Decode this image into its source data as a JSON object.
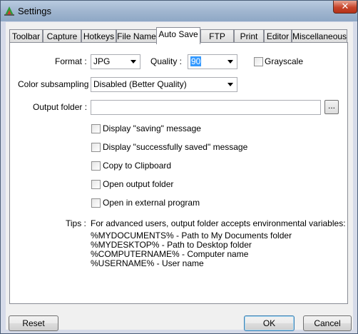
{
  "window": {
    "title": "Settings"
  },
  "tabs": [
    {
      "label": "Toolbar"
    },
    {
      "label": "Capture"
    },
    {
      "label": "Hotkeys"
    },
    {
      "label": "File Name"
    },
    {
      "label": "Auto Save",
      "active": true
    },
    {
      "label": "FTP"
    },
    {
      "label": "Print"
    },
    {
      "label": "Editor"
    },
    {
      "label": "Miscellaneous"
    }
  ],
  "form": {
    "format_label": "Format :",
    "format_value": "JPG",
    "quality_label": "Quality :",
    "quality_value": "90",
    "grayscale_label": "Grayscale",
    "grayscale_checked": false,
    "subsampling_label": "Color subsampling",
    "subsampling_value": "Disabled (Better Quality)",
    "output_folder_label": "Output folder :",
    "output_folder_value": "",
    "browse_label": "...",
    "options": [
      {
        "label": "Display \"saving\" message",
        "checked": false
      },
      {
        "label": "Display \"successfully saved\" message",
        "checked": false
      },
      {
        "label": "Copy to Clipboard",
        "checked": false
      },
      {
        "label": "Open output folder",
        "checked": false
      },
      {
        "label": "Open in external program",
        "checked": false
      }
    ],
    "tips_label": "Tips :",
    "tips_lines": [
      "For advanced users, output folder accepts environmental variables:",
      "%MYDOCUMENTS% - Path to My Documents folder",
      "%MYDESKTOP% - Path to Desktop folder",
      "%COMPUTERNAME% - Computer name",
      "%USERNAME% - User name"
    ]
  },
  "buttons": {
    "reset": "Reset",
    "ok": "OK",
    "cancel": "Cancel"
  },
  "colors": {
    "accent": "#3399ff",
    "close_button": "#c7442a"
  }
}
